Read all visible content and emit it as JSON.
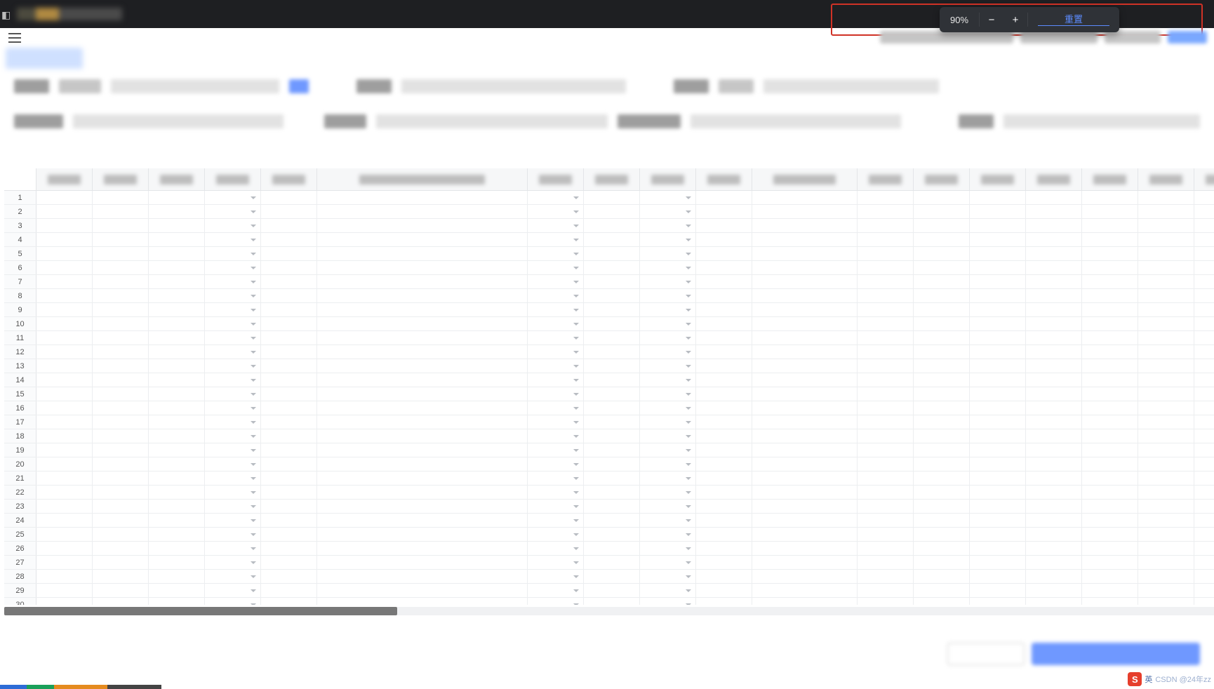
{
  "zoom": {
    "percent": "90%",
    "minus_glyph": "−",
    "plus_glyph": "+",
    "reset_label": "重置"
  },
  "ime": {
    "badge": "S",
    "lang": "英",
    "watermark": "CSDN @24年zz"
  },
  "grid": {
    "row_count": 30,
    "dropdown_col_indices": [
      3,
      6,
      8
    ],
    "col_sizes": [
      "nrw",
      "nrw",
      "nrw",
      "nrw",
      "nrw",
      "wide",
      "nrw",
      "nrw",
      "nrw",
      "nrw",
      "mid",
      "nrw",
      "nrw",
      "nrw",
      "nrw",
      "nrw",
      "nrw",
      "nrw"
    ]
  }
}
